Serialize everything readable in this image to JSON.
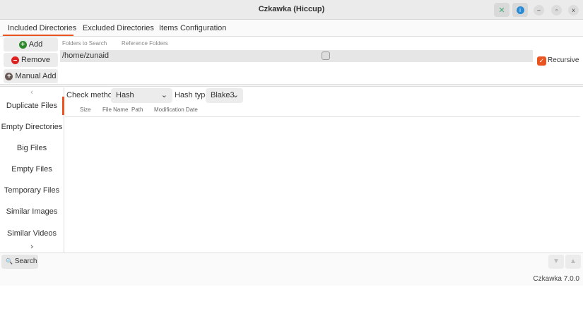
{
  "window": {
    "title": "Czkawka (Hiccup)"
  },
  "tabs": [
    "Included Directories",
    "Excluded Directories",
    "Items Configuration"
  ],
  "dir_buttons": {
    "add": "Add",
    "remove": "Remove",
    "manual_add": "Manual Add"
  },
  "subheaders": {
    "folders": "Folders to Search",
    "reference": "Reference Folders"
  },
  "directories": [
    "/home/zunaid"
  ],
  "recursive": {
    "label": "Recursive",
    "checked": true
  },
  "sidebar": [
    "Duplicate Files",
    "Empty Directories",
    "Big Files",
    "Empty Files",
    "Temporary Files",
    "Similar Images",
    "Similar Videos"
  ],
  "options": {
    "check_method_label": "Check method",
    "check_method_value": "Hash",
    "hash_type_label": "Hash type",
    "hash_type_value": "Blake3"
  },
  "columns": [
    "Size",
    "File Name",
    "Path",
    "Modification Date"
  ],
  "bottom": {
    "search": "Search",
    "version": "Czkawka 7.0.0"
  },
  "colors": {
    "accent": "#e95420"
  }
}
